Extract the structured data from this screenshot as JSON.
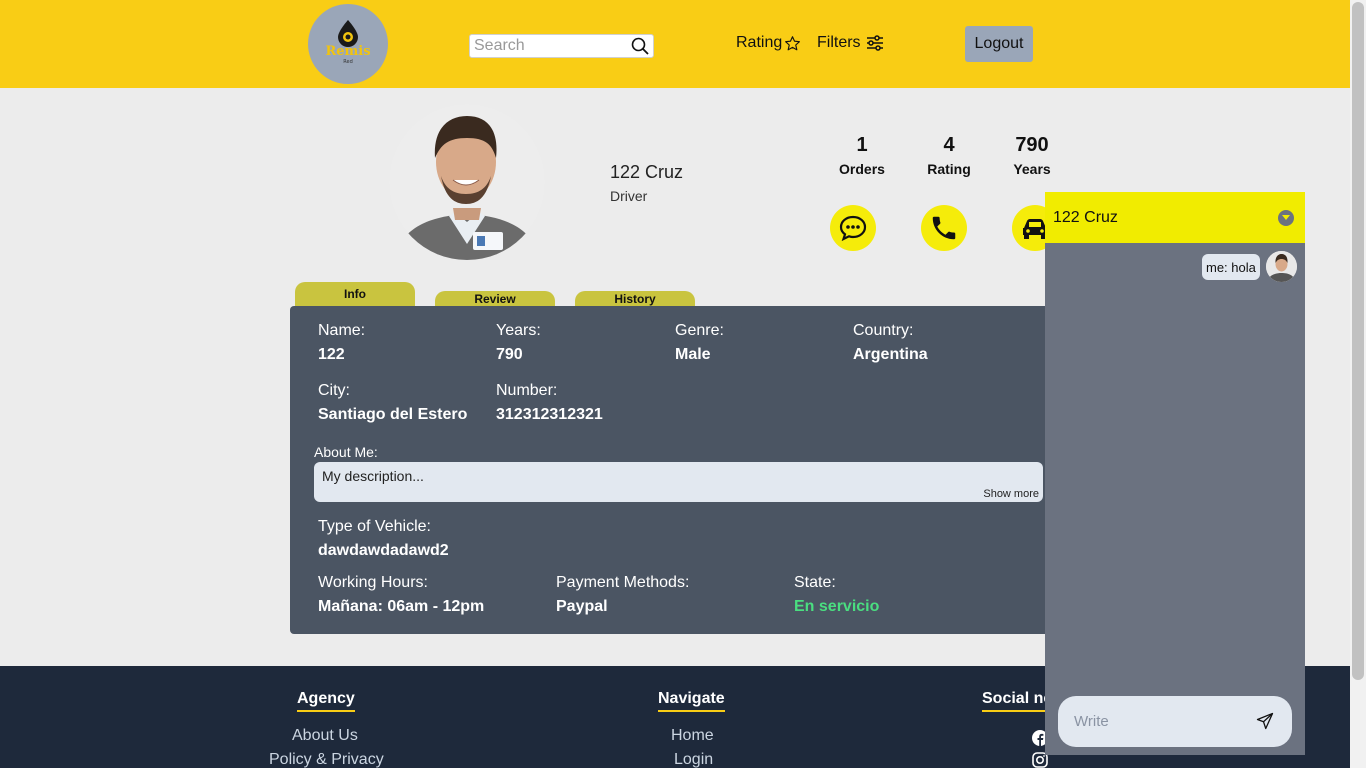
{
  "header": {
    "logo_text": "Remis",
    "logo_subtext": "Red",
    "search_placeholder": "Search",
    "rating_label": "Rating",
    "filters_label": "Filters",
    "logout_label": "Logout",
    "bg_color": "#f9cd15"
  },
  "profile": {
    "name": "122 Cruz",
    "role": "Driver",
    "stats": [
      {
        "value": "1",
        "label": "Orders"
      },
      {
        "value": "4",
        "label": "Rating"
      },
      {
        "value": "790",
        "label": "Years"
      }
    ],
    "actions": [
      "chat-icon",
      "phone-icon",
      "car-icon"
    ]
  },
  "tabs": [
    "Info",
    "Review",
    "History"
  ],
  "info": {
    "name_label": "Name:",
    "name_value": "122",
    "years_label": "Years:",
    "years_value": "790",
    "genre_label": "Genre:",
    "genre_value": "Male",
    "country_label": "Country:",
    "country_value": "Argentina",
    "city_label": "City:",
    "city_value": "Santiago del Estero",
    "number_label": "Number:",
    "number_value": "312312312321",
    "about_label": "About Me:",
    "about_text": "My description...",
    "show_more": "Show more",
    "vehicle_label": "Type of Vehicle:",
    "vehicle_value": "dawdawdadawd2",
    "hours_label": "Working Hours:",
    "hours_value": "Mañana: 06am - 12pm",
    "payment_label": "Payment Methods:",
    "payment_value": "Paypal",
    "state_label": "State:",
    "state_value": "En servicio",
    "state_color": "#4ade80"
  },
  "footer": {
    "agency_title": "Agency",
    "agency_links": [
      "About Us",
      "Policy & Privacy"
    ],
    "navigate_title": "Navigate",
    "navigate_links": [
      "Home",
      "Login"
    ],
    "social_title": "Social ne",
    "social_icons": [
      "facebook-icon",
      "instagram-icon"
    ]
  },
  "chat": {
    "title": "122 Cruz",
    "message": "me: hola",
    "input_placeholder": "Write"
  }
}
